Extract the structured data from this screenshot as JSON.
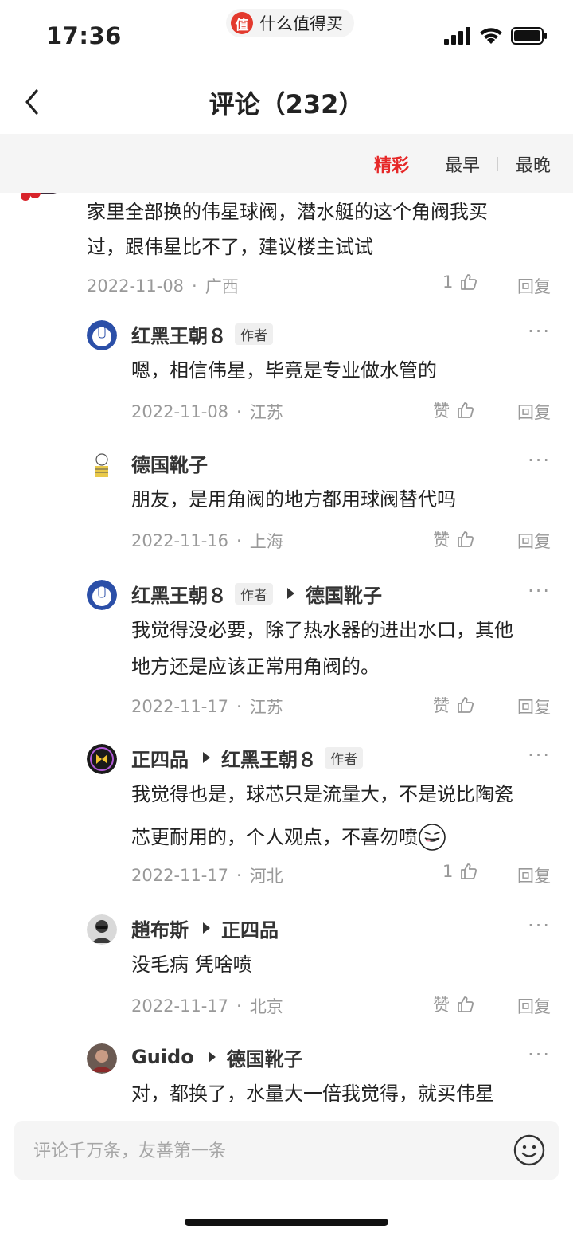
{
  "status_bar": {
    "time": "17:36",
    "app_logo_char": "值",
    "app_name": "什么值得买",
    "icons": [
      "signal-icon",
      "wifi-icon",
      "battery-icon"
    ]
  },
  "header": {
    "title": "评论（232）"
  },
  "sort": {
    "options": [
      "精彩",
      "最早",
      "最晚"
    ],
    "active": "精彩",
    "active_color": "#e62828"
  },
  "comments": [
    {
      "body": [
        "家里全部换的伟星球阀，潜水艇的这个角阀我买",
        "过，跟伟星比不了，建议楼主试试"
      ],
      "date": "2022-11-08",
      "location": "广西",
      "likes": "1",
      "reply_label": "回复"
    }
  ],
  "replies": [
    {
      "author": "红黑王朝８",
      "author_tag": "作者",
      "reply_to": "",
      "reply_to_tag": "",
      "body": [
        "嗯，相信伟星，毕竟是专业做水管的"
      ],
      "date": "2022-11-08",
      "location": "江苏",
      "likes": "赞",
      "reply_label": "回复"
    },
    {
      "author": "德国靴子",
      "author_tag": "",
      "reply_to": "",
      "reply_to_tag": "",
      "body": [
        "朋友，是用角阀的地方都用球阀替代吗"
      ],
      "date": "2022-11-16",
      "location": "上海",
      "likes": "赞",
      "reply_label": "回复"
    },
    {
      "author": "红黑王朝８",
      "author_tag": "作者",
      "reply_to": "德国靴子",
      "reply_to_tag": "",
      "body": [
        "我觉得没必要，除了热水器的进出水口，其他",
        "地方还是应该正常用角阀的。"
      ],
      "date": "2022-11-17",
      "location": "江苏",
      "likes": "赞",
      "reply_label": "回复"
    },
    {
      "author": "正四品",
      "author_tag": "",
      "reply_to": "红黑王朝８",
      "reply_to_tag": "作者",
      "body": [
        "我觉得也是，球芯只是流量大，不是说比陶瓷",
        "芯更耐用的，个人观点，不喜勿喷"
      ],
      "date": "2022-11-17",
      "location": "河北",
      "likes": "1",
      "reply_label": "回复"
    },
    {
      "author": "趙布斯",
      "author_tag": "",
      "reply_to": "正四品",
      "reply_to_tag": "",
      "body": [
        "没毛病 凭啥喷"
      ],
      "date": "2022-11-17",
      "location": "北京",
      "likes": "赞",
      "reply_label": "回复"
    },
    {
      "author": "Guido",
      "author_tag": "",
      "reply_to": "德国靴子",
      "reply_to_tag": "",
      "body": [
        "对，都换了，水量大一倍我觉得，就买伟星"
      ],
      "date": "",
      "location": "",
      "likes": "",
      "reply_label": ""
    }
  ],
  "more_label": "···",
  "dot": "·",
  "input": {
    "placeholder": "评论千万条，友善第一条"
  }
}
